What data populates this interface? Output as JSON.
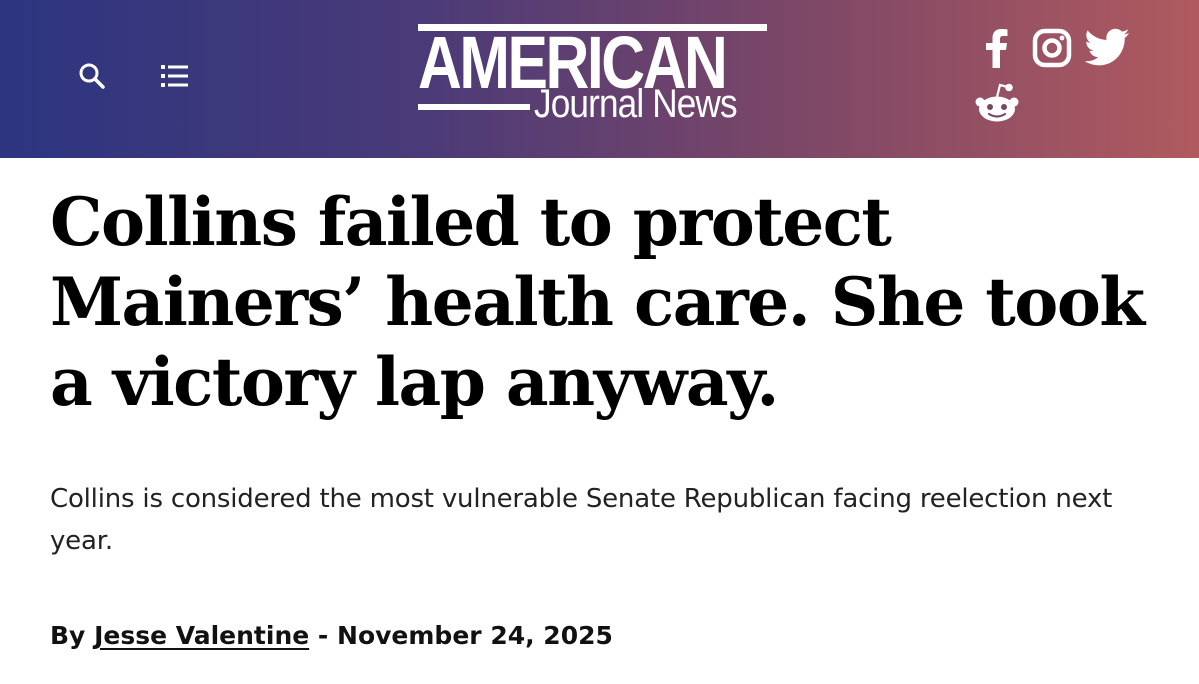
{
  "header": {
    "logo_main": "AMERICAN",
    "logo_sub": "Journal News",
    "left_icons": [
      "search-icon",
      "list-menu-icon"
    ],
    "social_icons": [
      "facebook-icon",
      "instagram-icon",
      "twitter-icon",
      "reddit-icon"
    ],
    "gradient_colors": [
      "#2c3580",
      "#7a4668",
      "#b05a5e"
    ]
  },
  "article": {
    "headline": "Collins failed to protect Mainers’ health care. She took a victory lap anyway.",
    "subhead": "Collins is considered the most vulnerable Senate Republican facing reelection next year.",
    "byline": {
      "prefix": "By",
      "author": "Jesse Valentine",
      "separator": "-",
      "date": "November 24, 2025"
    }
  }
}
